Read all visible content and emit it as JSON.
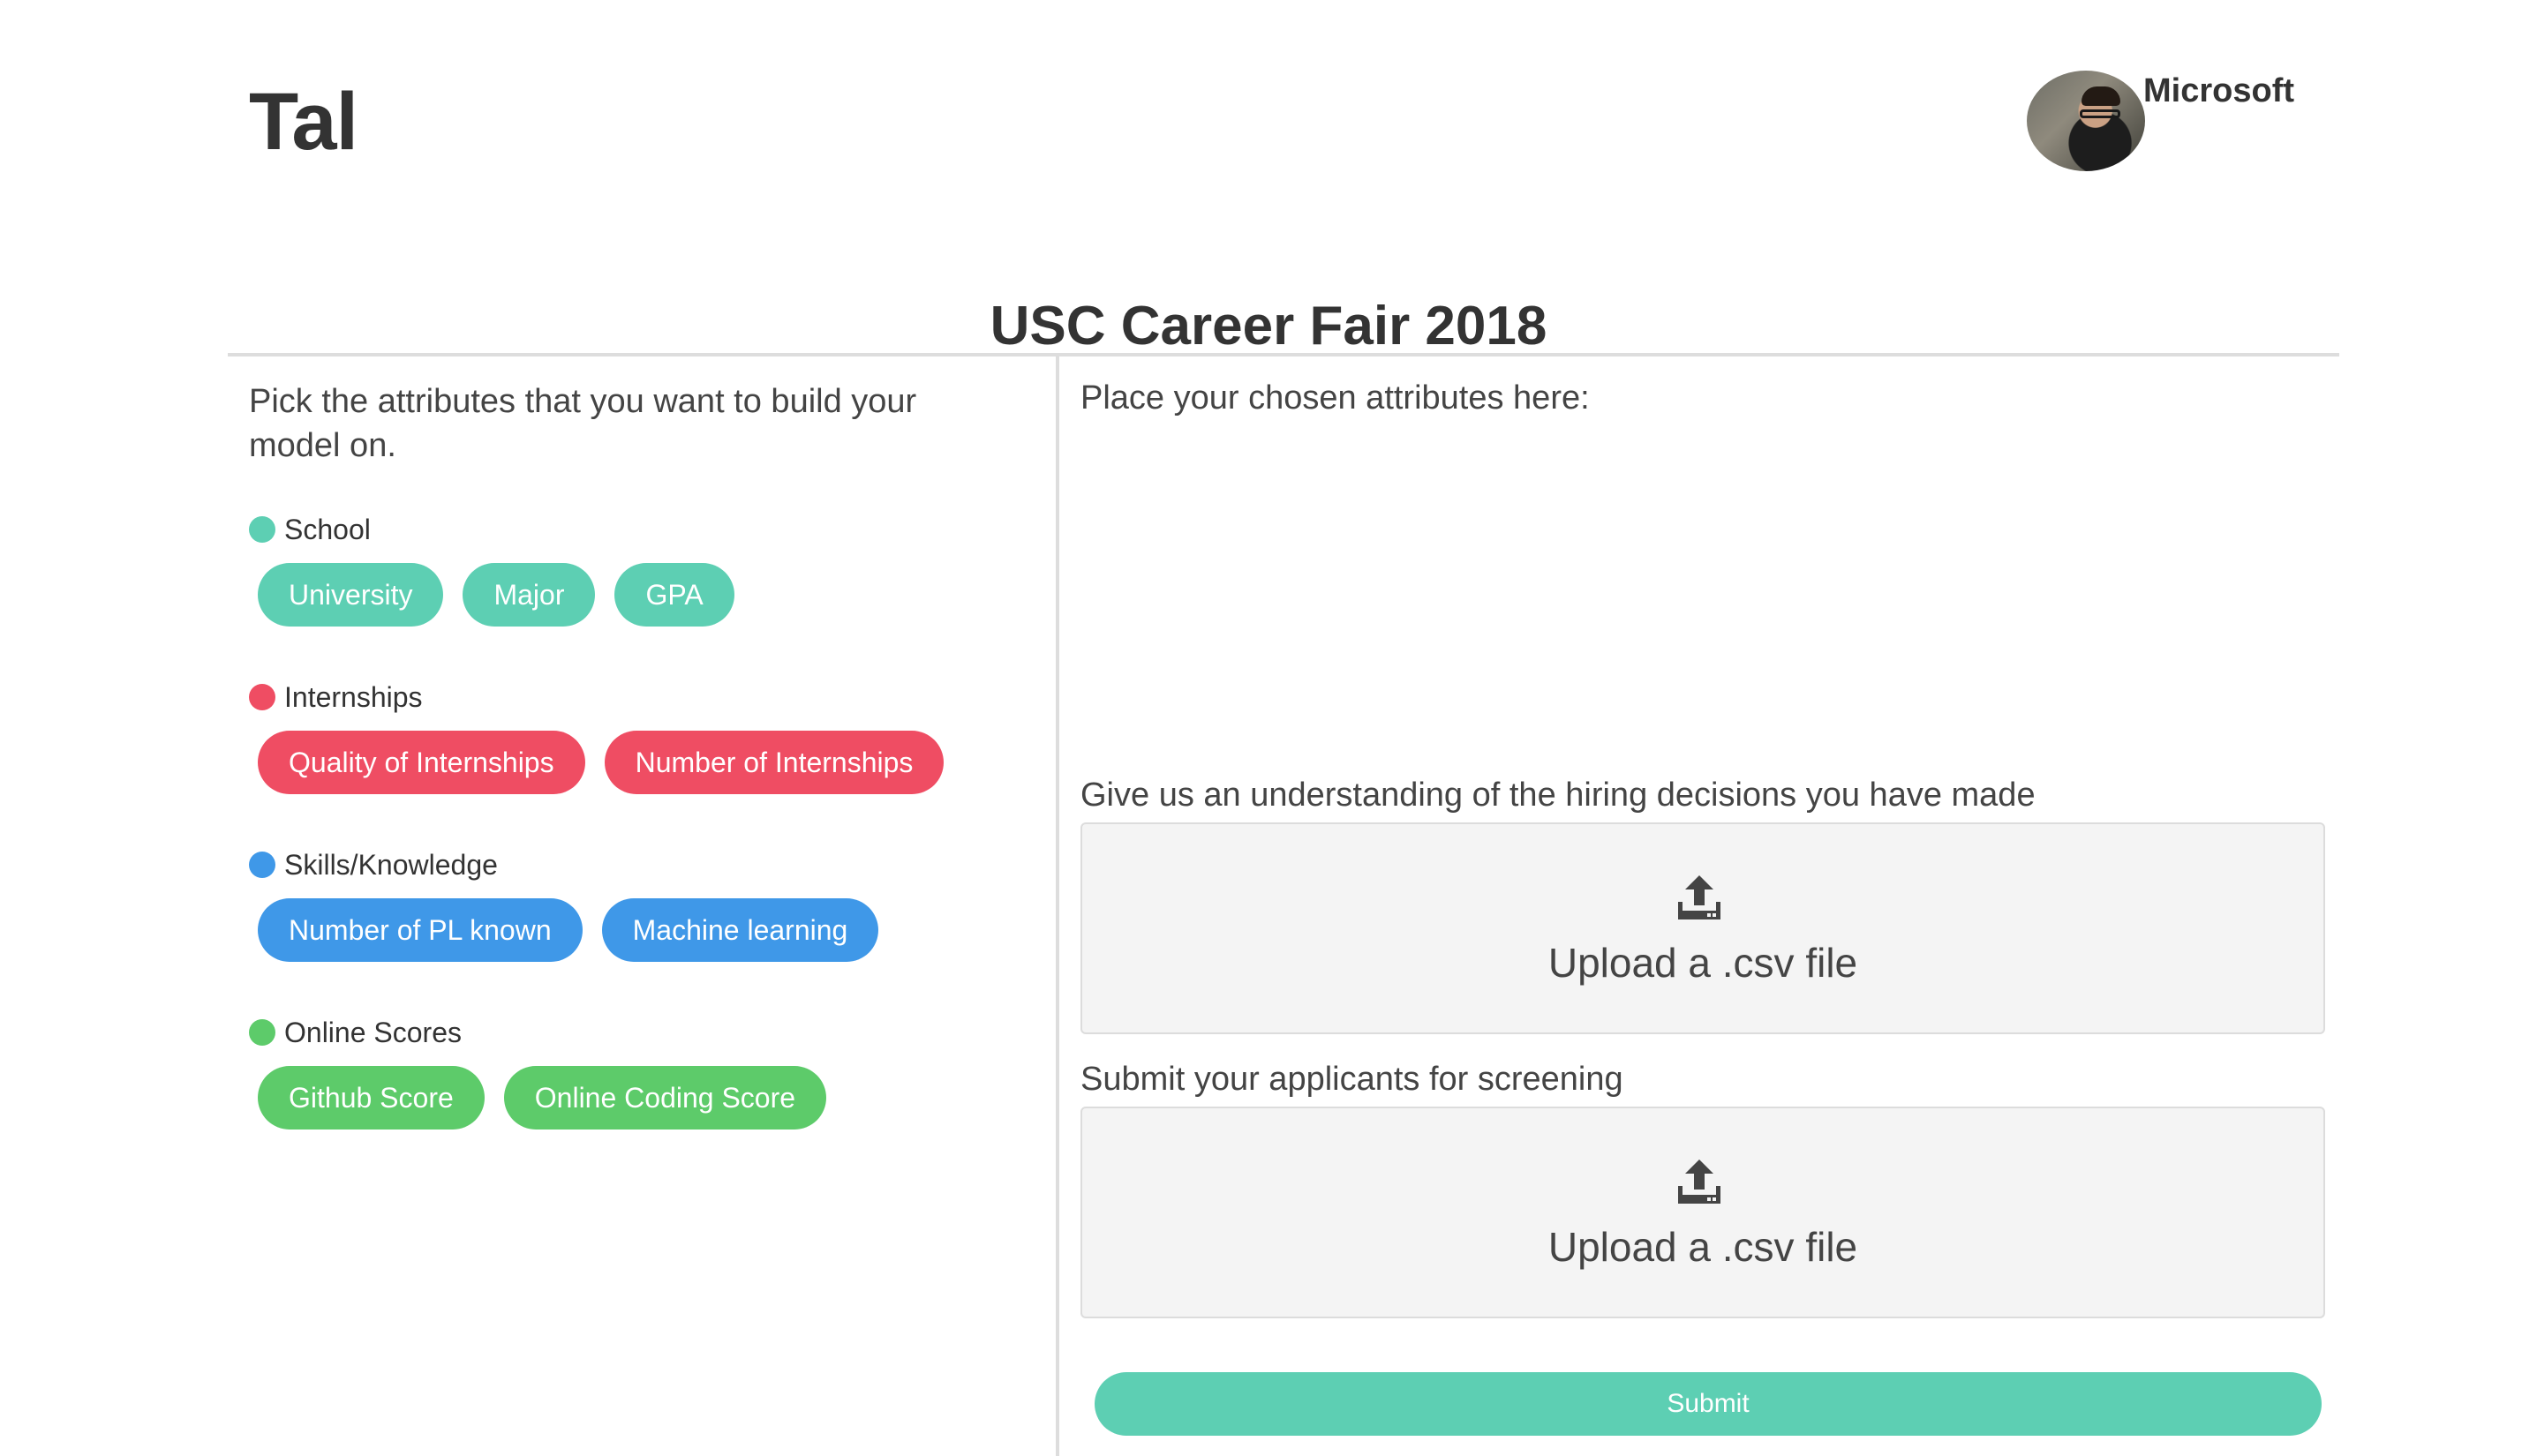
{
  "header": {
    "brand": "Tal",
    "user_name": "Microsoft"
  },
  "event_title": "USC Career Fair 2018",
  "left": {
    "intro": "Pick the attributes that you want to build your model on.",
    "groups": [
      {
        "label": "School",
        "color": "#5dcfb3",
        "pills": [
          "University",
          "Major",
          "GPA"
        ]
      },
      {
        "label": "Internships",
        "color": "#ef4d63",
        "pills": [
          "Quality of Internships",
          "Number of Internships"
        ]
      },
      {
        "label": "Skills/Knowledge",
        "color": "#3f98e8",
        "pills": [
          "Number of PL known",
          "Machine learning"
        ]
      },
      {
        "label": "Online Scores",
        "color": "#5dcb6a",
        "pills": [
          "Github Score",
          "Online Coding Score"
        ]
      }
    ]
  },
  "right": {
    "drop_label": "Place your chosen attributes here:",
    "hiring_label": "Give us an understanding of the hiring decisions you have made",
    "hiring_upload": {
      "icon": "upload-icon",
      "label": "Upload a .csv file"
    },
    "screening_label": "Submit your applicants for screening",
    "screening_upload": {
      "icon": "upload-icon",
      "label": "Upload a .csv file"
    },
    "submit_label": "Submit"
  }
}
